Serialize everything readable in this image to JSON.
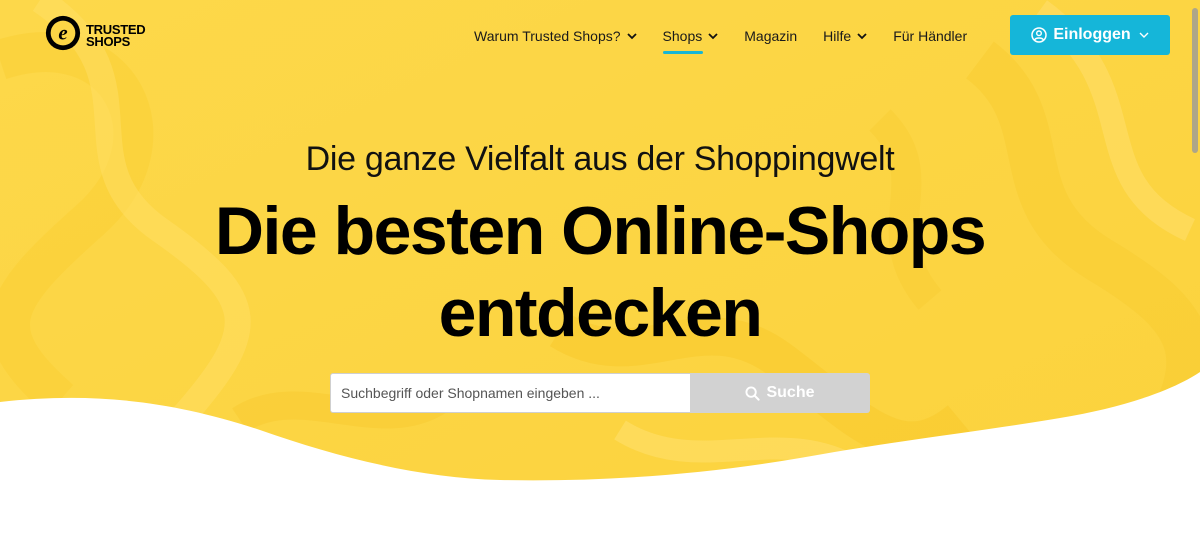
{
  "brand": {
    "line1": "TRUSTED",
    "line2": "SHOPS",
    "mark": "e",
    "accent_color": "#15b6d9",
    "hero_color": "#fcd646"
  },
  "nav": {
    "items": [
      {
        "label": "Warum Trusted Shops?",
        "has_dropdown": true
      },
      {
        "label": "Shops",
        "has_dropdown": true,
        "active": true
      },
      {
        "label": "Magazin",
        "has_dropdown": false
      },
      {
        "label": "Hilfe",
        "has_dropdown": true
      },
      {
        "label": "Für Händler",
        "has_dropdown": false
      }
    ],
    "login_label": "Einloggen"
  },
  "hero": {
    "subtitle": "Die ganze Vielfalt aus der Shoppingwelt",
    "title_line1": "Die besten Online-Shops",
    "title_line2": "entdecken"
  },
  "search": {
    "placeholder": "Suchbegriff oder Shopnamen eingeben ...",
    "value": "",
    "button_label": "Suche"
  },
  "icons": [
    "logo-e-icon",
    "chevron-down-icon",
    "user-circle-icon",
    "search-icon"
  ]
}
